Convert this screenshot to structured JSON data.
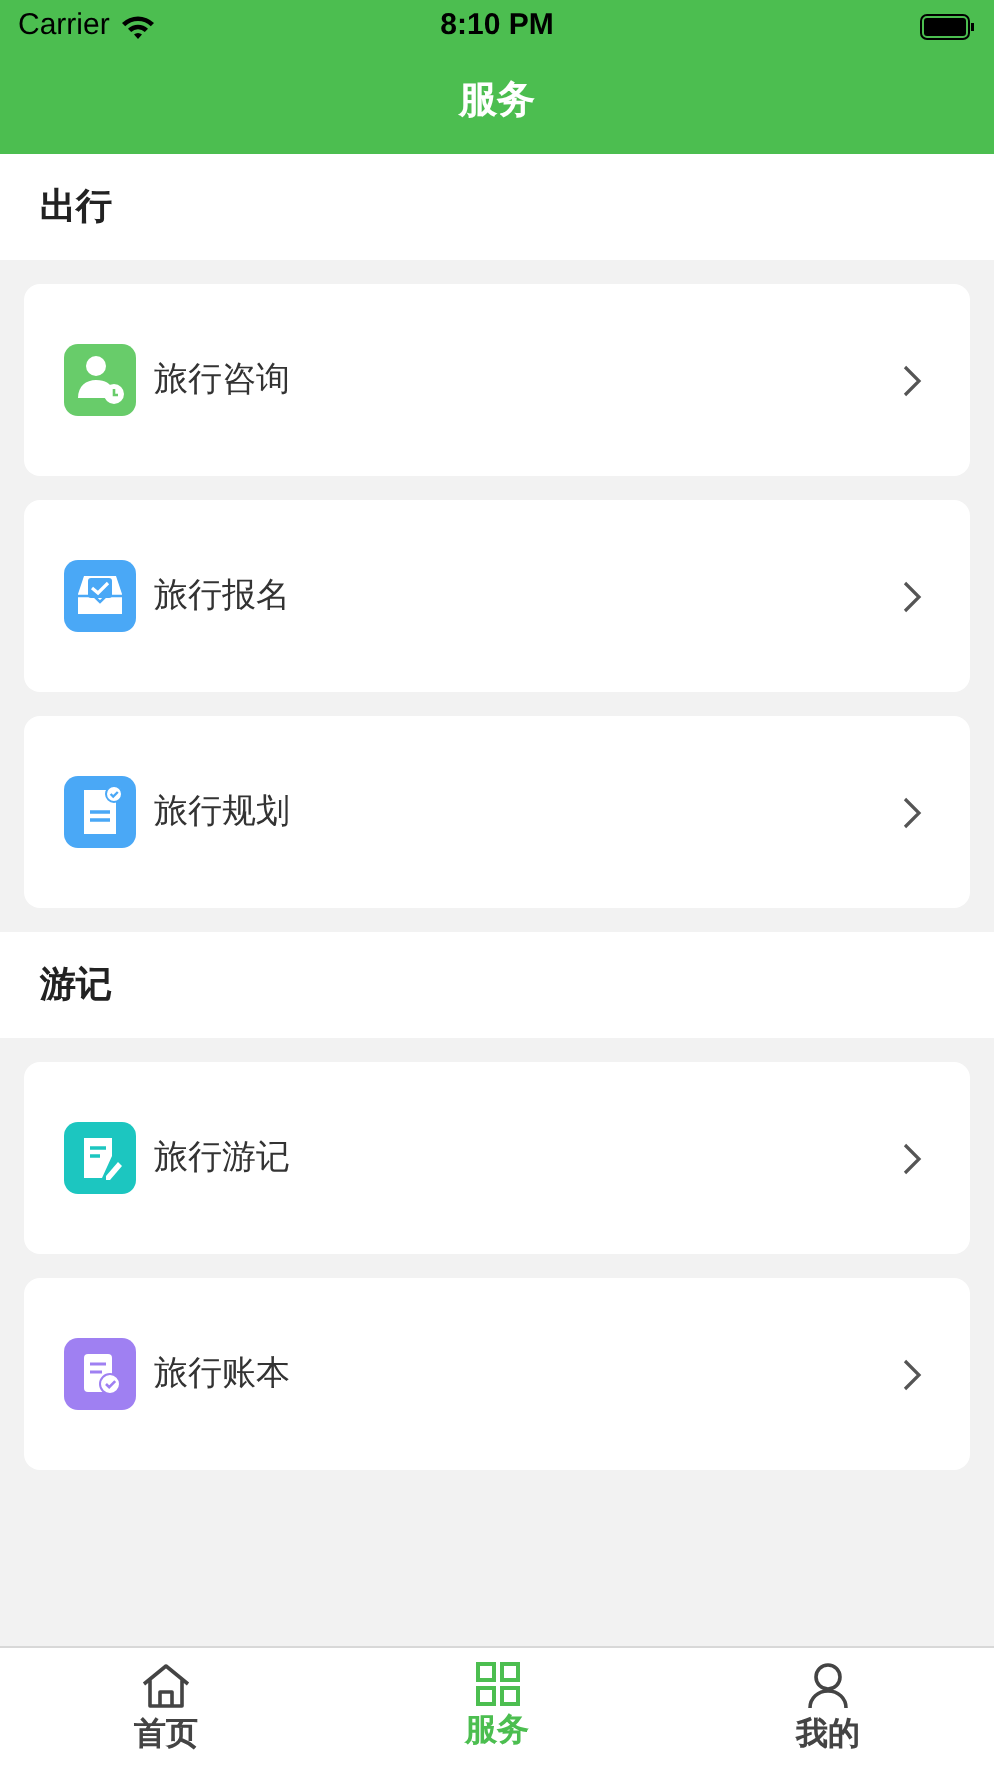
{
  "status_bar": {
    "carrier": "Carrier",
    "time": "8:10 PM"
  },
  "nav": {
    "title": "服务"
  },
  "sections": [
    {
      "title": "出行",
      "items": [
        {
          "label": "旅行咨询",
          "kind": "consult",
          "color": "#68cc6a"
        },
        {
          "label": "旅行报名",
          "kind": "signup",
          "color": "#4aa8f6"
        },
        {
          "label": "旅行规划",
          "kind": "plan",
          "color": "#4aa8f6"
        }
      ]
    },
    {
      "title": "游记",
      "items": [
        {
          "label": "旅行游记",
          "kind": "journal",
          "color": "#1cc6c0"
        },
        {
          "label": "旅行账本",
          "kind": "ledger",
          "color": "#9f80f2"
        }
      ]
    }
  ],
  "tabs": [
    {
      "label": "首页",
      "kind": "home",
      "selected": false
    },
    {
      "label": "服务",
      "kind": "grid",
      "selected": true
    },
    {
      "label": "我的",
      "kind": "person",
      "selected": false
    }
  ]
}
